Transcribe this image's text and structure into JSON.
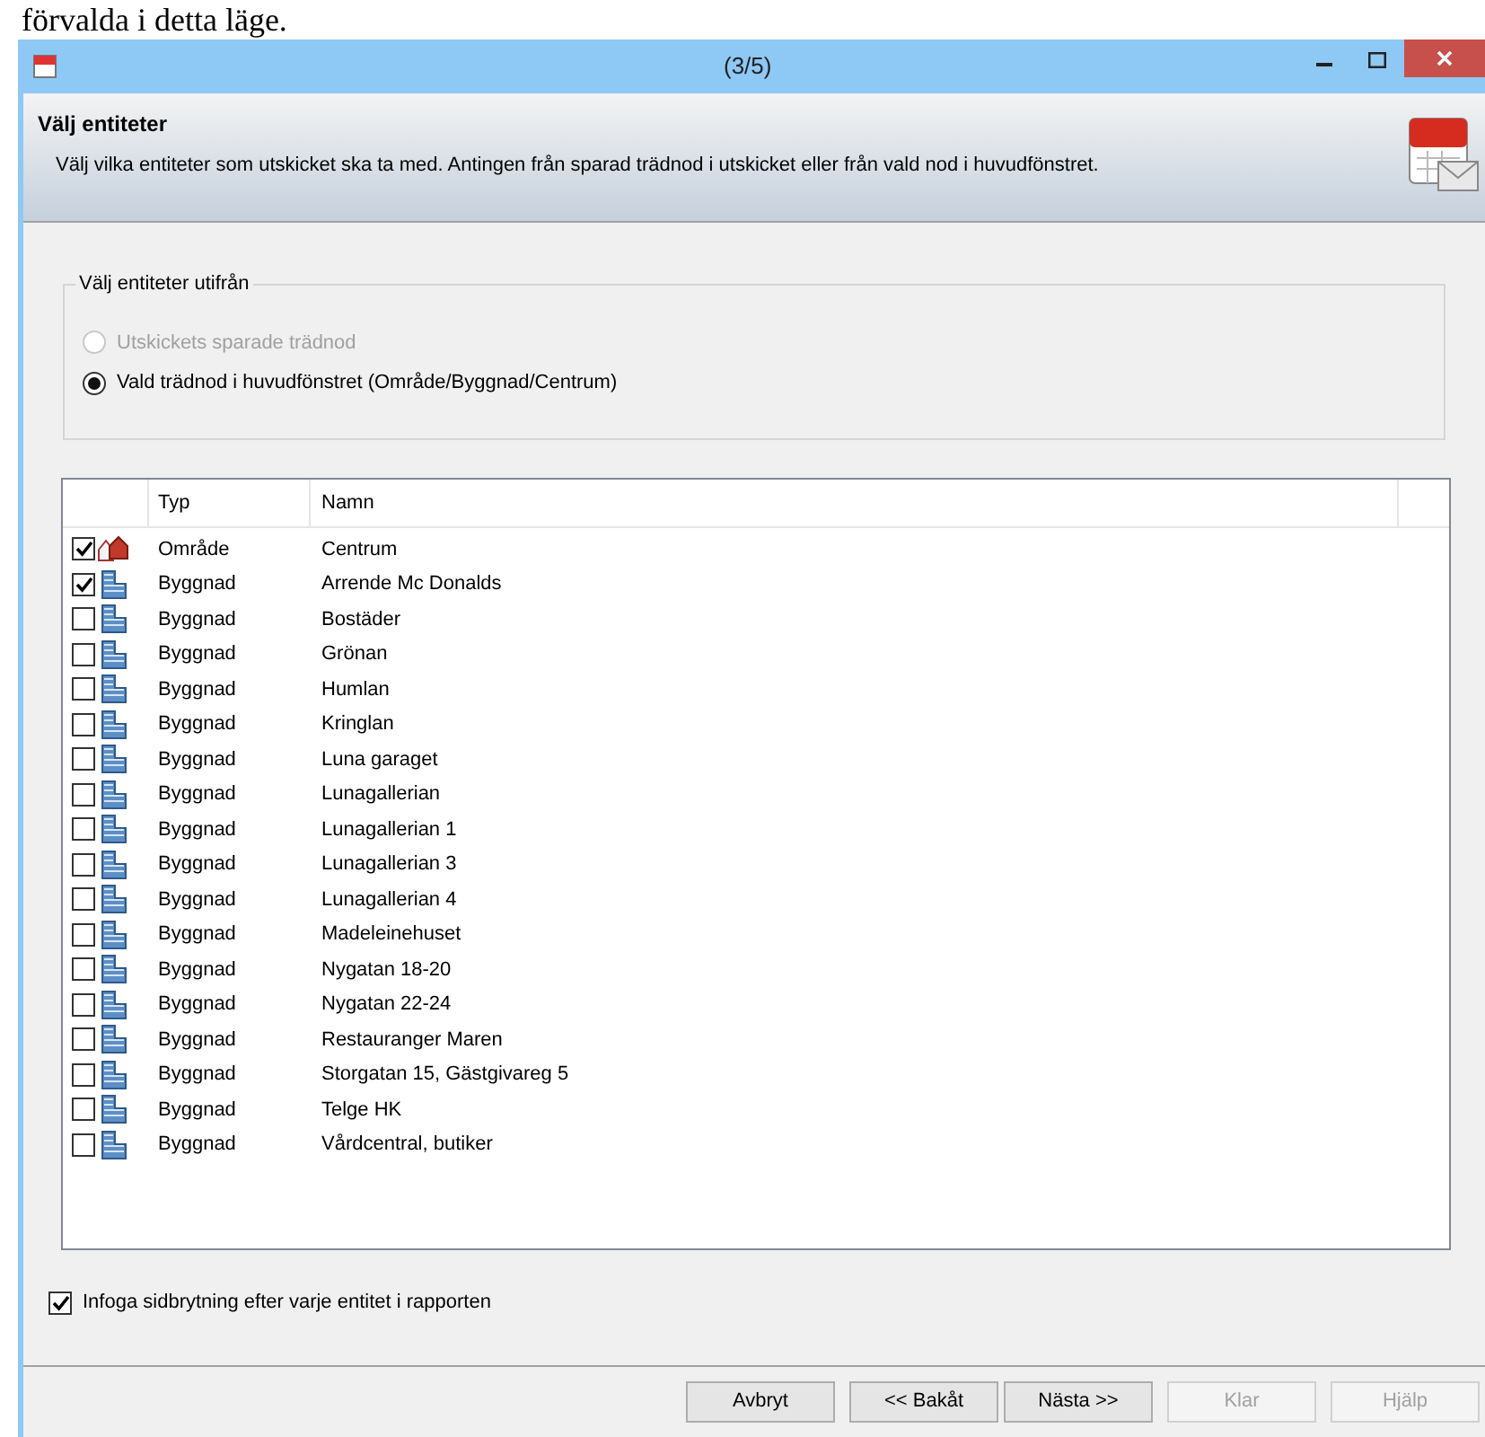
{
  "page_caption": "förvalda i detta läge.",
  "window": {
    "title": "(3/5)"
  },
  "header": {
    "title": "Välj entiteter",
    "description": "Välj vilka entiteter som utskicket ska ta med. Antingen från sparad trädnod i utskicket eller från vald nod i huvudfönstret."
  },
  "group": {
    "legend": "Välj entiteter utifrån",
    "options": [
      {
        "label": "Utskickets sparade trädnod",
        "selected": false,
        "disabled": true
      },
      {
        "label": "Vald trädnod i huvudfönstret (Område/Byggnad/Centrum)",
        "selected": true,
        "disabled": false
      }
    ]
  },
  "table": {
    "columns": [
      "Typ",
      "Namn"
    ],
    "rows": [
      {
        "kind": "area",
        "checked": true,
        "type": "Område",
        "name": "Centrum"
      },
      {
        "kind": "building",
        "checked": true,
        "type": "Byggnad",
        "name": "Arrende Mc Donalds"
      },
      {
        "kind": "building",
        "checked": false,
        "type": "Byggnad",
        "name": "Bostäder"
      },
      {
        "kind": "building",
        "checked": false,
        "type": "Byggnad",
        "name": "Grönan"
      },
      {
        "kind": "building",
        "checked": false,
        "type": "Byggnad",
        "name": "Humlan"
      },
      {
        "kind": "building",
        "checked": false,
        "type": "Byggnad",
        "name": "Kringlan"
      },
      {
        "kind": "building",
        "checked": false,
        "type": "Byggnad",
        "name": "Luna garaget"
      },
      {
        "kind": "building",
        "checked": false,
        "type": "Byggnad",
        "name": "Lunagallerian"
      },
      {
        "kind": "building",
        "checked": false,
        "type": "Byggnad",
        "name": "Lunagallerian 1"
      },
      {
        "kind": "building",
        "checked": false,
        "type": "Byggnad",
        "name": "Lunagallerian 3"
      },
      {
        "kind": "building",
        "checked": false,
        "type": "Byggnad",
        "name": "Lunagallerian 4"
      },
      {
        "kind": "building",
        "checked": false,
        "type": "Byggnad",
        "name": "Madeleinehuset"
      },
      {
        "kind": "building",
        "checked": false,
        "type": "Byggnad",
        "name": "Nygatan 18-20"
      },
      {
        "kind": "building",
        "checked": false,
        "type": "Byggnad",
        "name": "Nygatan 22-24"
      },
      {
        "kind": "building",
        "checked": false,
        "type": "Byggnad",
        "name": "Restauranger Maren"
      },
      {
        "kind": "building",
        "checked": false,
        "type": "Byggnad",
        "name": "Storgatan 15, Gästgivareg 5"
      },
      {
        "kind": "building",
        "checked": false,
        "type": "Byggnad",
        "name": "Telge HK"
      },
      {
        "kind": "building",
        "checked": false,
        "type": "Byggnad",
        "name": "Vårdcentral, butiker"
      }
    ]
  },
  "page_break_option": {
    "label": "Infoga sidbrytning efter varje entitet i rapporten",
    "checked": true
  },
  "buttons": [
    {
      "label": "Avbryt",
      "disabled": false
    },
    {
      "label": "<< Bakåt",
      "disabled": false
    },
    {
      "label": "Nästa >>",
      "disabled": false
    },
    {
      "label": "Klar",
      "disabled": true
    },
    {
      "label": "Hjälp",
      "disabled": true
    }
  ]
}
